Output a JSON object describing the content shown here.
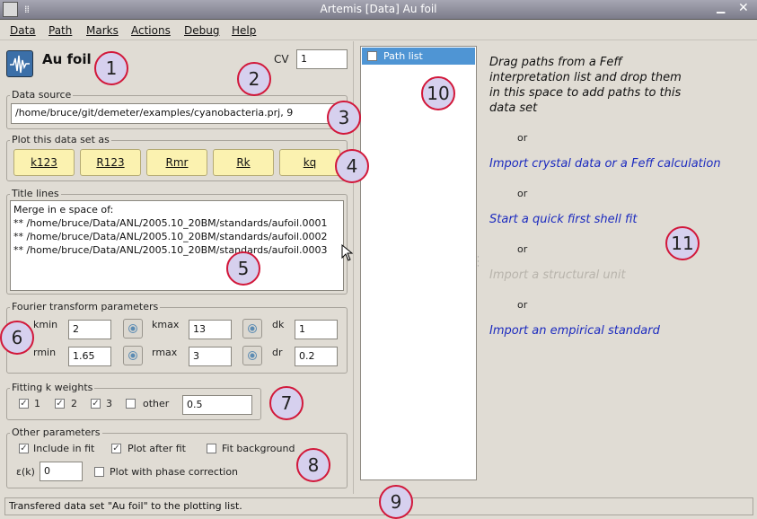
{
  "window": {
    "title": "Artemis [Data] Au foil"
  },
  "menu": [
    "Data",
    "Path",
    "Marks",
    "Actions",
    "Debug",
    "Help"
  ],
  "header": {
    "dataset_name": "Au foil",
    "cv_label": "CV",
    "cv_value": "1"
  },
  "data_source": {
    "legend": "Data source",
    "value": "/home/bruce/git/demeter/examples/cyanobacteria.prj, 9"
  },
  "plot": {
    "legend": "Plot this data set as",
    "buttons": [
      "k123",
      "R123",
      "Rmr",
      "Rk",
      "kq"
    ]
  },
  "title_lines": {
    "legend": "Title lines",
    "lines": [
      "Merge in e space of:",
      "** /home/bruce/Data/ANL/2005.10_20BM/standards/aufoil.0001",
      "** /home/bruce/Data/ANL/2005.10_20BM/standards/aufoil.0002",
      "** /home/bruce/Data/ANL/2005.10_20BM/standards/aufoil.0003"
    ]
  },
  "fourier": {
    "legend": "Fourier transform parameters",
    "kmin_label": "kmin",
    "kmin": "2",
    "kmax_label": "kmax",
    "kmax": "13",
    "dk_label": "dk",
    "dk": "1",
    "rmin_label": "rmin",
    "rmin": "1.65",
    "rmax_label": "rmax",
    "rmax": "3",
    "dr_label": "dr",
    "dr": "0.2"
  },
  "kweights": {
    "legend": "Fitting k weights",
    "w1": "1",
    "w2": "2",
    "w3": "3",
    "other_label": "other",
    "other_value": "0.5"
  },
  "other": {
    "legend": "Other parameters",
    "include_in_fit": "Include in fit",
    "plot_after_fit": "Plot after fit",
    "fit_background": "Fit background",
    "epsilon_label": "ε(k)",
    "epsilon_value": "0",
    "phase_correction": "Plot with phase correction"
  },
  "path_list": {
    "header": "Path list"
  },
  "help": {
    "drag_lines": [
      "Drag paths from a Feff",
      "interpretation list and drop them",
      "in this space to add paths to this",
      "data set"
    ],
    "or": "or",
    "import_crystal": "Import crystal data or a Feff calculation",
    "quick_fit": "Start a quick first shell fit",
    "structural_unit": "Import a structural unit",
    "empirical": "Import an empirical standard"
  },
  "status": "Transfered data set \"Au foil\" to the plotting list.",
  "callouts": [
    "1",
    "2",
    "3",
    "4",
    "5",
    "6",
    "7",
    "8",
    "9",
    "10",
    "11"
  ]
}
